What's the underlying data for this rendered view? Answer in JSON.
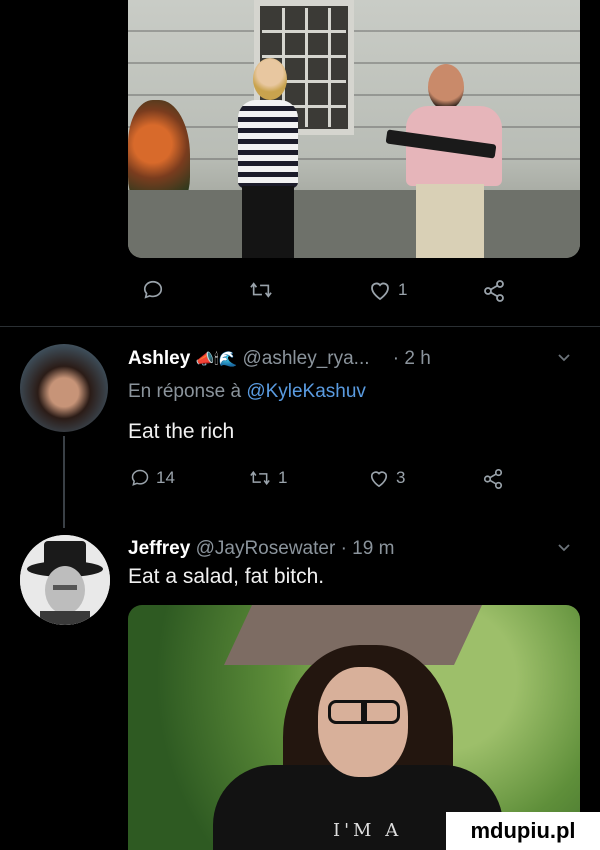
{
  "top_post_actions": {
    "retweet_count": "",
    "like_count": "1"
  },
  "reply1": {
    "name": "Ashley",
    "handle": "@ashley_rya...",
    "time": "· 2 h",
    "reply_prefix": "En réponse à",
    "reply_to": "@KyleKashuv",
    "text": "Eat the rich",
    "counts": {
      "replies": "14",
      "retweets": "1",
      "likes": "3"
    }
  },
  "reply2": {
    "name": "Jeffrey",
    "handle": "@JayRosewater",
    "time": "· 19 m",
    "text": "Eat a salad, fat bitch."
  },
  "bottom_photo": {
    "shirt_text": "I'M A"
  },
  "watermark": "mdupiu.pl",
  "icons": [
    "reply-icon",
    "retweet-icon",
    "like-icon",
    "share-icon",
    "chevron-down-icon"
  ],
  "colors": {
    "background": "#000000",
    "muted": "#8b949c",
    "text": "#f1f1f1"
  }
}
